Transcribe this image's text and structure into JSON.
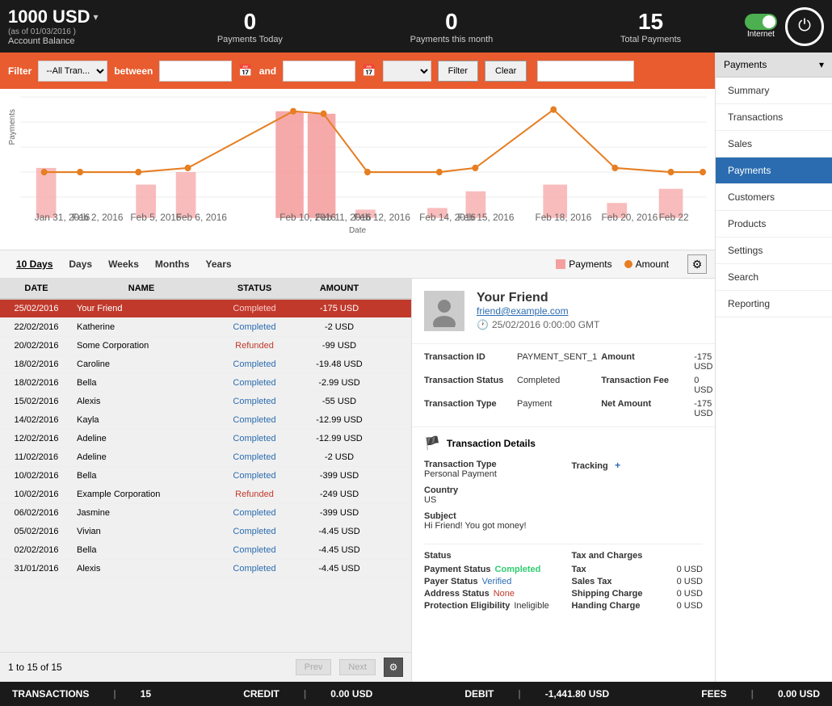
{
  "header": {
    "balance_amount": "1000 USD",
    "balance_arrow": "▾",
    "balance_date": "(as of 01/03/2016 )",
    "balance_label": "Account Balance",
    "stat1_number": "0",
    "stat1_label": "Payments Today",
    "stat2_number": "0",
    "stat2_label": "Payments this month",
    "stat3_number": "15",
    "stat3_label": "Total Payments",
    "internet_label": "Internet"
  },
  "filter_bar": {
    "filter_label": "Filter",
    "all_tran_option": "--All Tran...",
    "between_label": "between",
    "and_label": "and",
    "filter_btn": "Filter",
    "clear_btn": "Clear"
  },
  "sidebar": {
    "dropdown_label": "Payments",
    "items": [
      {
        "label": "Summary",
        "active": false
      },
      {
        "label": "Transactions",
        "active": false
      },
      {
        "label": "Sales",
        "active": false
      },
      {
        "label": "Payments",
        "active": true
      },
      {
        "label": "Customers",
        "active": false
      },
      {
        "label": "Products",
        "active": false
      },
      {
        "label": "Settings",
        "active": false
      },
      {
        "label": "Search",
        "active": false
      },
      {
        "label": "Reporting",
        "active": false
      }
    ]
  },
  "chart": {
    "y_label": "Payments",
    "x_label": "Date",
    "dates": [
      "Jan 31, 2016",
      "Feb 2, 2016",
      "Feb 5, 2016",
      "Feb 6, 2016",
      "Feb 10, 2016",
      "Feb 11, 2016",
      "Feb 12, 2016",
      "Feb 14, 2016",
      "Feb 15, 2016",
      "Feb 18, 2016",
      "Feb 20, 2016",
      "Feb 22"
    ],
    "legend_payments": "Payments",
    "legend_amount": "Amount"
  },
  "time_tabs": [
    "10 Days",
    "Days",
    "Weeks",
    "Months",
    "Years"
  ],
  "table": {
    "headers": [
      "DATE",
      "NAME",
      "STATUS",
      "AMOUNT"
    ],
    "rows": [
      {
        "date": "25/02/2016",
        "name": "Your Friend",
        "status": "Completed",
        "amount": "-175 USD",
        "selected": true
      },
      {
        "date": "22/02/2016",
        "name": "Katherine",
        "status": "Completed",
        "amount": "-2 USD",
        "selected": false
      },
      {
        "date": "20/02/2016",
        "name": "Some Corporation",
        "status": "Refunded",
        "amount": "-99 USD",
        "selected": false
      },
      {
        "date": "18/02/2016",
        "name": "Caroline",
        "status": "Completed",
        "amount": "-19.48 USD",
        "selected": false
      },
      {
        "date": "18/02/2016",
        "name": "Bella",
        "status": "Completed",
        "amount": "-2.99 USD",
        "selected": false
      },
      {
        "date": "15/02/2016",
        "name": "Alexis",
        "status": "Completed",
        "amount": "-55 USD",
        "selected": false
      },
      {
        "date": "14/02/2016",
        "name": "Kayla",
        "status": "Completed",
        "amount": "-12.99 USD",
        "selected": false
      },
      {
        "date": "12/02/2016",
        "name": "Adeline",
        "status": "Completed",
        "amount": "-12.99 USD",
        "selected": false
      },
      {
        "date": "11/02/2016",
        "name": "Adeline",
        "status": "Completed",
        "amount": "-2 USD",
        "selected": false
      },
      {
        "date": "10/02/2016",
        "name": "Bella",
        "status": "Completed",
        "amount": "-399 USD",
        "selected": false
      },
      {
        "date": "10/02/2016",
        "name": "Example Corporation",
        "status": "Refunded",
        "amount": "-249 USD",
        "selected": false
      },
      {
        "date": "06/02/2016",
        "name": "Jasmine",
        "status": "Completed",
        "amount": "-399 USD",
        "selected": false
      },
      {
        "date": "05/02/2016",
        "name": "Vivian",
        "status": "Completed",
        "amount": "-4.45 USD",
        "selected": false
      },
      {
        "date": "02/02/2016",
        "name": "Bella",
        "status": "Completed",
        "amount": "-4.45 USD",
        "selected": false
      },
      {
        "date": "31/01/2016",
        "name": "Alexis",
        "status": "Completed",
        "amount": "-4.45 USD",
        "selected": false
      }
    ],
    "pagination": "1 to 15 of 15",
    "prev_btn": "Prev",
    "next_btn": "Next"
  },
  "detail": {
    "name": "Your Friend",
    "email": "friend@example.com",
    "date": "25/02/2016 0:00:00  GMT",
    "transaction_id_label": "Transaction ID",
    "transaction_id": "PAYMENT_SENT_1",
    "amount_label": "Amount",
    "amount": "-175 USD",
    "transaction_status_label": "Transaction Status",
    "transaction_status": "Completed",
    "transaction_fee_label": "Transaction Fee",
    "transaction_fee": "0 USD",
    "transaction_type_label": "Transaction Type",
    "transaction_type": "Payment",
    "net_amount_label": "Net Amount",
    "net_amount": "-175 USD",
    "details_header": "Transaction Details",
    "type_label": "Transaction Type",
    "type_value": "Personal Payment",
    "country_label": "Country",
    "country_value": "US",
    "tracking_label": "Tracking",
    "tracking_btn": "+",
    "subject_label": "Subject",
    "subject_value": "Hi Friend! You got money!",
    "status_label": "Status",
    "tax_charges_label": "Tax and Charges",
    "payment_status_label": "Payment Status",
    "payment_status": "Completed",
    "tax_label": "Tax",
    "tax_value": "0 USD",
    "payer_status_label": "Payer Status",
    "payer_status": "Verified",
    "sales_tax_label": "Sales Tax",
    "sales_tax_value": "0 USD",
    "address_status_label": "Address Status",
    "address_status": "None",
    "shipping_label": "Shipping Charge",
    "shipping_value": "0 USD",
    "protection_label": "Protection Eligibility",
    "protection_value": "Ineligible",
    "handing_label": "Handing Charge",
    "handing_value": "0 USD"
  },
  "status_bar": {
    "transactions_label": "TRANSACTIONS",
    "transactions_count": "15",
    "credit_label": "CREDIT",
    "credit_value": "0.00 USD",
    "debit_label": "DEBIT",
    "debit_value": "-1,441.80 USD",
    "fees_label": "FEES",
    "fees_value": "0.00 USD"
  }
}
